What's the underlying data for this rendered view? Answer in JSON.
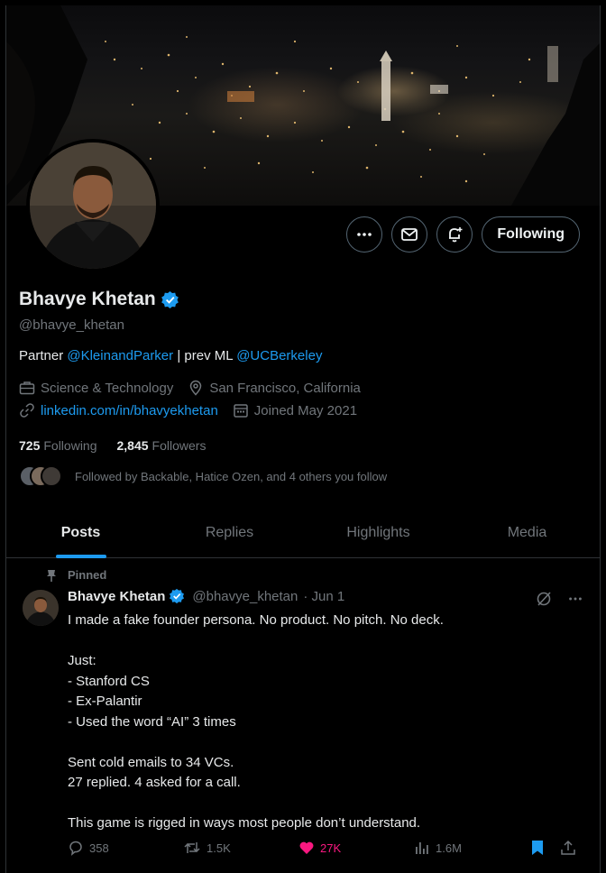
{
  "profile": {
    "display_name": "Bhavye Khetan",
    "handle": "@bhavye_khetan",
    "bio_prefix": "Partner ",
    "bio_link1": "@KleinandParker",
    "bio_mid": " | prev ML ",
    "bio_link2": "@UCBerkeley",
    "category": "Science & Technology",
    "location": "San Francisco, California",
    "website": "linkedin.com/in/bhavyekhetan",
    "joined": "Joined May 2021",
    "following_count": "725",
    "following_label": "Following",
    "followers_count": "2,845",
    "followers_label": "Followers",
    "followed_by": "Followed by Backable, Hatice Ozen, and 4 others you follow"
  },
  "actions": {
    "follow_label": "Following"
  },
  "tabs": [
    {
      "label": "Posts",
      "active": true
    },
    {
      "label": "Replies",
      "active": false
    },
    {
      "label": "Highlights",
      "active": false
    },
    {
      "label": "Media",
      "active": false
    }
  ],
  "tweet": {
    "pinned_label": "Pinned",
    "name": "Bhavye Khetan",
    "handle": "@bhavye_khetan",
    "date": "· Jun 1",
    "body": "I made a fake founder persona. No product. No pitch. No deck.\n\nJust:\n- Stanford CS\n- Ex-Palantir\n- Used the word “AI” 3 times\n\nSent cold emails to 34 VCs.\n27 replied. 4 asked for a call.\n\nThis game is rigged in ways most people don’t understand.",
    "replies": "358",
    "reposts": "1.5K",
    "likes": "27K",
    "views": "1.6M"
  },
  "colors": {
    "accent": "#1d9bf0",
    "like": "#f91880",
    "muted": "#71767b",
    "border": "#2f3336"
  }
}
